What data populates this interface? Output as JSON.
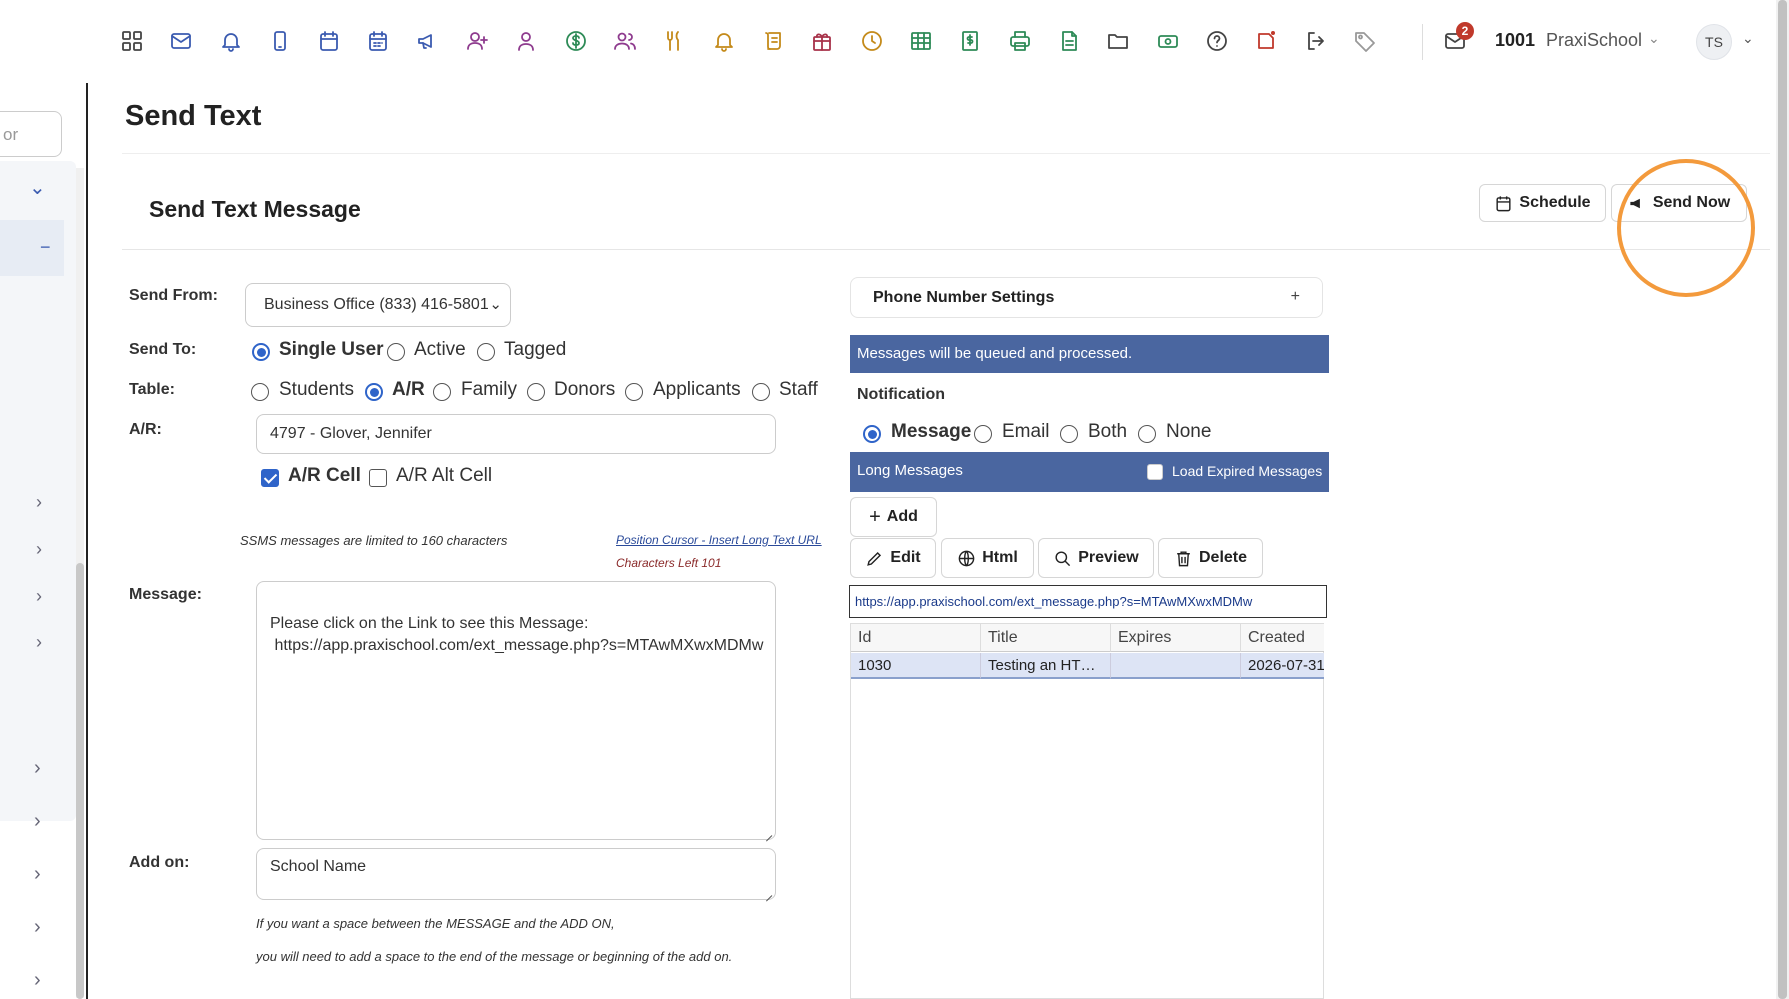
{
  "topbar": {
    "icons": [
      "grid-icon",
      "mail-icon",
      "bell-icon",
      "phone-icon",
      "calendar-icon",
      "calendar-grid-icon",
      "megaphone-icon",
      "add-user-icon",
      "user-icon",
      "dollar-icon",
      "users-icon",
      "utensils-icon",
      "bell-alert-icon",
      "scroll-icon",
      "gift-icon",
      "clock-icon",
      "table-icon",
      "receipt-icon",
      "printer-icon",
      "document-icon",
      "folder-icon",
      "cash-icon",
      "help-icon",
      "notes-icon",
      "logout-icon",
      "tag-icon"
    ],
    "mail_badge": "2",
    "school_id": "1001",
    "school_name": "PraxiSchool",
    "avatar_initials": "TS",
    "accent_color": "#2f64c9"
  },
  "sidebar": {
    "search_placeholder": "or",
    "collapse_label": "−"
  },
  "page": {
    "title": "Send Text",
    "card_title": "Send Text Message",
    "schedule_label": "Schedule",
    "send_now_label": "Send Now"
  },
  "form": {
    "send_from_label": "Send From:",
    "send_from_value": "Business Office (833) 416-5801",
    "send_to_label": "Send To:",
    "send_to_options": [
      "Single User",
      "Active",
      "Tagged"
    ],
    "send_to_selected": "Single User",
    "table_label": "Table:",
    "table_options": [
      "Students",
      "A/R",
      "Family",
      "Donors",
      "Applicants",
      "Staff"
    ],
    "table_selected": "A/R",
    "ar_label": "A/R:",
    "ar_value": "4797 - Glover, Jennifer",
    "ar_cell_label": "A/R Cell",
    "ar_cell_checked": true,
    "ar_alt_cell_label": "A/R Alt Cell",
    "ar_alt_cell_checked": false,
    "sms_limit_note": "SSMS messages are limited to 160 characters",
    "insert_url_link": "Position Cursor - Insert Long Text URL",
    "chars_left": "Characters Left 101",
    "message_label": "Message:",
    "message_line1": "Please click on the Link to see this Message:",
    "message_line2": " https://app.praxischool.com/ext_message.php?s=MTAwMXwxMDMw",
    "add_on_label": "Add on:",
    "add_on_value": "School Name",
    "add_on_note1": "If you want a space between the MESSAGE and the ADD ON,",
    "add_on_note2": "you will need to add a space to the end of the message or beginning of the add on."
  },
  "right": {
    "phone_settings_title": "Phone Number Settings",
    "phone_settings_toggle": "+",
    "queue_banner": "Messages will be queued and processed.",
    "notification_label": "Notification",
    "notification_options": [
      "Message",
      "Email",
      "Both",
      "None"
    ],
    "notification_selected": "Message",
    "long_messages_title": "Long Messages",
    "load_expired_label": "Load Expired Messages",
    "add_label": "Add",
    "edit_label": "Edit",
    "html_label": "Html",
    "preview_label": "Preview",
    "delete_label": "Delete",
    "url_value": "https://app.praxischool.com/ext_message.php?s=MTAwMXwxMDMw",
    "grid_headers": [
      "Id",
      "Title",
      "Expires",
      "Created"
    ],
    "grid_rows": [
      [
        "1030",
        "Testing an HT…",
        "",
        "2026-07-31"
      ]
    ],
    "banner_color": "#4a66a0"
  }
}
